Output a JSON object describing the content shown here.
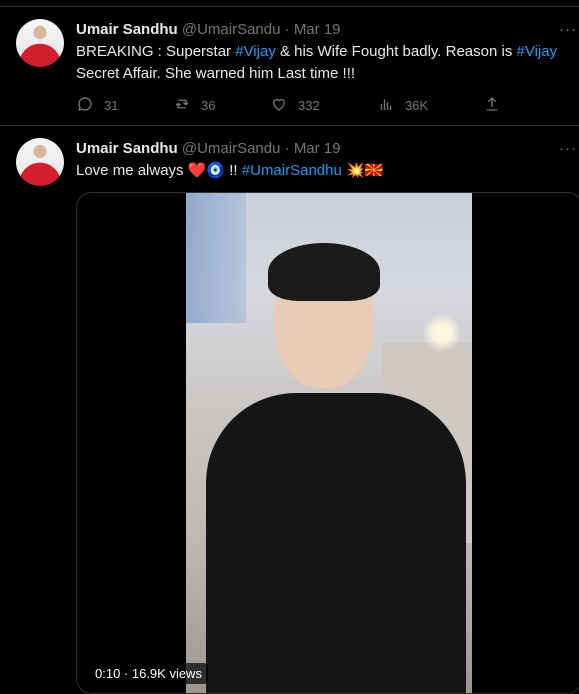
{
  "tweets": [
    {
      "name": "Umair Sandhu",
      "handle": "@UmairSandu",
      "date": "Mar 19",
      "text_parts": [
        "BREAKING : Superstar ",
        "#Vijay",
        " & his Wife Fought badly. Reason is ",
        "#Vijay",
        " Secret Affair. She warned him Last time !!!"
      ],
      "actions": {
        "replies": "31",
        "retweets": "36",
        "likes": "332",
        "views": "36K"
      }
    },
    {
      "name": "Umair Sandhu",
      "handle": "@UmairSandu",
      "date": "Mar 19",
      "text_parts": [
        "Love me always ",
        "❤️",
        "🧿",
        " !! ",
        "#UmairSandhu",
        " 💥",
        "🇲🇰"
      ],
      "video": {
        "badge": "0:10 · 16.9K views"
      }
    }
  ],
  "ui": {
    "more": "···",
    "dot": " · "
  },
  "icons": [
    "reply-icon",
    "retweet-icon",
    "like-icon",
    "views-icon",
    "share-icon",
    "more-icon"
  ],
  "colors": {
    "background": "#000000",
    "text": "#e7e9ea",
    "muted": "#71767b",
    "link": "#1d9bf0",
    "divider": "#2f3336"
  }
}
